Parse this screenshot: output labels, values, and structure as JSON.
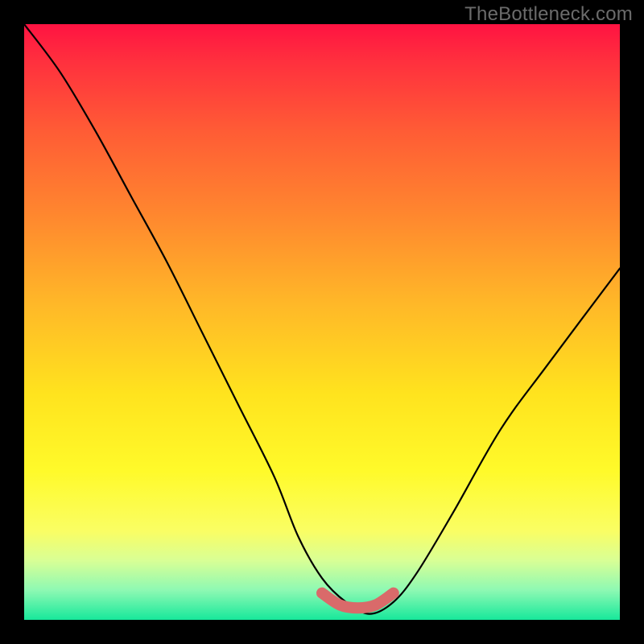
{
  "watermark": "TheBottleneck.com",
  "chart_data": {
    "type": "line",
    "title": "",
    "xlabel": "",
    "ylabel": "",
    "xlim": [
      0,
      100
    ],
    "ylim": [
      0,
      100
    ],
    "series": [
      {
        "name": "bottleneck-curve",
        "color": "#000000",
        "x": [
          0,
          6,
          12,
          18,
          24,
          30,
          36,
          42,
          46,
          50,
          54,
          58,
          62,
          66,
          72,
          80,
          88,
          100
        ],
        "y": [
          100,
          92,
          82,
          71,
          60,
          48,
          36,
          24,
          14,
          7,
          3,
          1,
          3,
          8,
          18,
          32,
          43,
          59
        ]
      },
      {
        "name": "optimal-zone",
        "color": "#d96a6a",
        "x": [
          50,
          53,
          56,
          59,
          62
        ],
        "y": [
          4.5,
          2.5,
          2,
          2.5,
          4.5
        ]
      }
    ],
    "annotations": []
  },
  "colors": {
    "background": "#000000",
    "gradient_top": "#ff1342",
    "gradient_mid": "#ffe31e",
    "gradient_bottom": "#17e89b",
    "curve": "#000000",
    "optimal_zone": "#d96a6a",
    "watermark": "#6b6b6b"
  }
}
